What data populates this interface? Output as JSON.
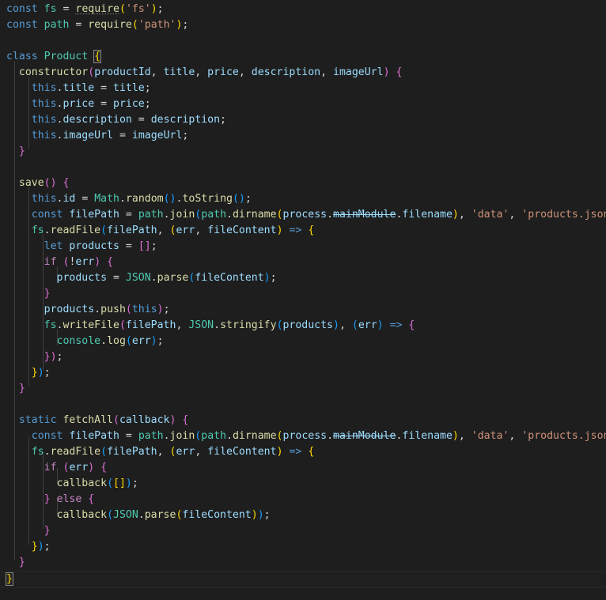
{
  "editor": {
    "language": "javascript",
    "theme": "dark-plus",
    "background_color": "#1e1e1e",
    "foreground_color": "#d4d4d4",
    "current_line_number": 34,
    "colors": {
      "keyword": "#569cd6",
      "control": "#c586c0",
      "function": "#dcdcaa",
      "variable": "#9cdcfe",
      "type": "#4ec9b0",
      "string": "#ce9178",
      "operator": "#d4d4d4",
      "bracket_level_1": "#ffd700",
      "bracket_level_2": "#da70d6",
      "bracket_level_3": "#179fff",
      "indent_guide": "#404040",
      "current_line_border": "#282828"
    }
  },
  "lines": {
    "l1": "const fs = require('fs');",
    "l2": "const path = require('path');",
    "l3": "",
    "l4": "class Product {",
    "l5": "  constructor(productId, title, price, description, imageUrl) {",
    "l6": "    this.title = title;",
    "l7": "    this.price = price;",
    "l8": "    this.description = description;",
    "l9": "    this.imageUrl = imageUrl;",
    "l10": "  }",
    "l11": "",
    "l12": "  save() {",
    "l13": "    this.id = Math.random().toString();",
    "l14": "    const filePath = path.join(path.dirname(process.mainModule.filename), 'data', 'products.json');",
    "l15": "    fs.readFile(filePath, (err, fileContent) => {",
    "l16": "      let products = [];",
    "l17": "      if (!err) {",
    "l18": "        products = JSON.parse(fileContent);",
    "l19": "      }",
    "l20": "      products.push(this);",
    "l21": "      fs.writeFile(filePath, JSON.stringify(products), (err) => {",
    "l22": "        console.log(err);",
    "l23": "      });",
    "l24": "    });",
    "l25": "  }",
    "l26": "",
    "l27": "  static fetchAll(callback) {",
    "l28": "    const filePath = path.join(path.dirname(process.mainModule.filename), 'data', 'products.json');",
    "l29": "    fs.readFile(filePath, (err, fileContent) => {",
    "l30": "      if (err) {",
    "l31": "        callback([]);",
    "l32": "      } else {",
    "l33": "        callback(JSON.parse(fileContent));",
    "l34": "      }",
    "l35": "    });",
    "l36": "  }",
    "l37": "}"
  },
  "tokens": {
    "kw_const": "const",
    "kw_class": "class",
    "kw_this": "this",
    "kw_let": "let",
    "kw_static": "static",
    "kw_if": "if",
    "kw_else": "else",
    "id_fs": "fs",
    "id_path": "path",
    "id_require": "require",
    "id_product": "Product",
    "id_constructor": "constructor",
    "id_productId": "productId",
    "id_title": "title",
    "id_price": "price",
    "id_description": "description",
    "id_imageUrl": "imageUrl",
    "id_save": "save",
    "id_Math": "Math",
    "id_random": "random",
    "id_toString": "toString",
    "id_id": "id",
    "id_filePath": "filePath",
    "id_join": "join",
    "id_dirname": "dirname",
    "id_process": "process",
    "id_mainModule": "mainModule",
    "id_filename": "filename",
    "id_readFile": "readFile",
    "id_writeFile": "writeFile",
    "id_err": "err",
    "id_fileContent": "fileContent",
    "id_products": "products",
    "id_JSON": "JSON",
    "id_parse": "parse",
    "id_stringify": "stringify",
    "id_push": "push",
    "id_console": "console",
    "id_log": "log",
    "id_fetchAll": "fetchAll",
    "id_callback": "callback",
    "str_fs": "'fs'",
    "str_path": "'path'",
    "str_data": "'data'",
    "str_products_json": "'products.json'",
    "op_eq": "=",
    "op_arrow": "=>",
    "op_not": "!",
    "op_dot": ".",
    "op_comma": ",",
    "op_semi": ";",
    "paren_open": "(",
    "paren_close": ")",
    "brace_open": "{",
    "brace_close": "}",
    "bracket_empty": "[]",
    "space": " "
  }
}
